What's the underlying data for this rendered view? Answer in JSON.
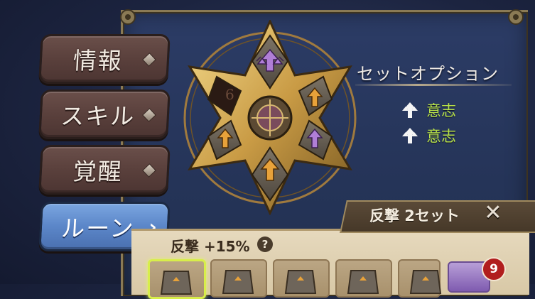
{
  "menu": {
    "items": [
      {
        "label": "情報",
        "active": false
      },
      {
        "label": "スキル",
        "active": false
      },
      {
        "label": "覚醒",
        "active": false
      },
      {
        "label": "ルーン",
        "active": true
      }
    ]
  },
  "rune_board": {
    "empty_slot_number": "6",
    "slots": [
      "purple-arrow-icon",
      "orange-arrow-icon",
      "purple-arrow-icon",
      "orange-arrow-icon",
      "orange-arrow-icon",
      "empty"
    ]
  },
  "set_options": {
    "title": "セットオプション",
    "items": [
      {
        "icon": "will-rune-icon",
        "label": "意志"
      },
      {
        "icon": "will-rune-icon",
        "label": "意志"
      }
    ]
  },
  "set_detail": {
    "header": "反撃 2セット",
    "effect": "反撃 +15%",
    "help": "?",
    "close": "✕",
    "inventory_count": "9"
  },
  "colors": {
    "accent_green": "#b8e14a",
    "active_tab": "#5b86c8",
    "purple_rune": "#b07ed6",
    "orange_rune": "#e8a23a"
  }
}
